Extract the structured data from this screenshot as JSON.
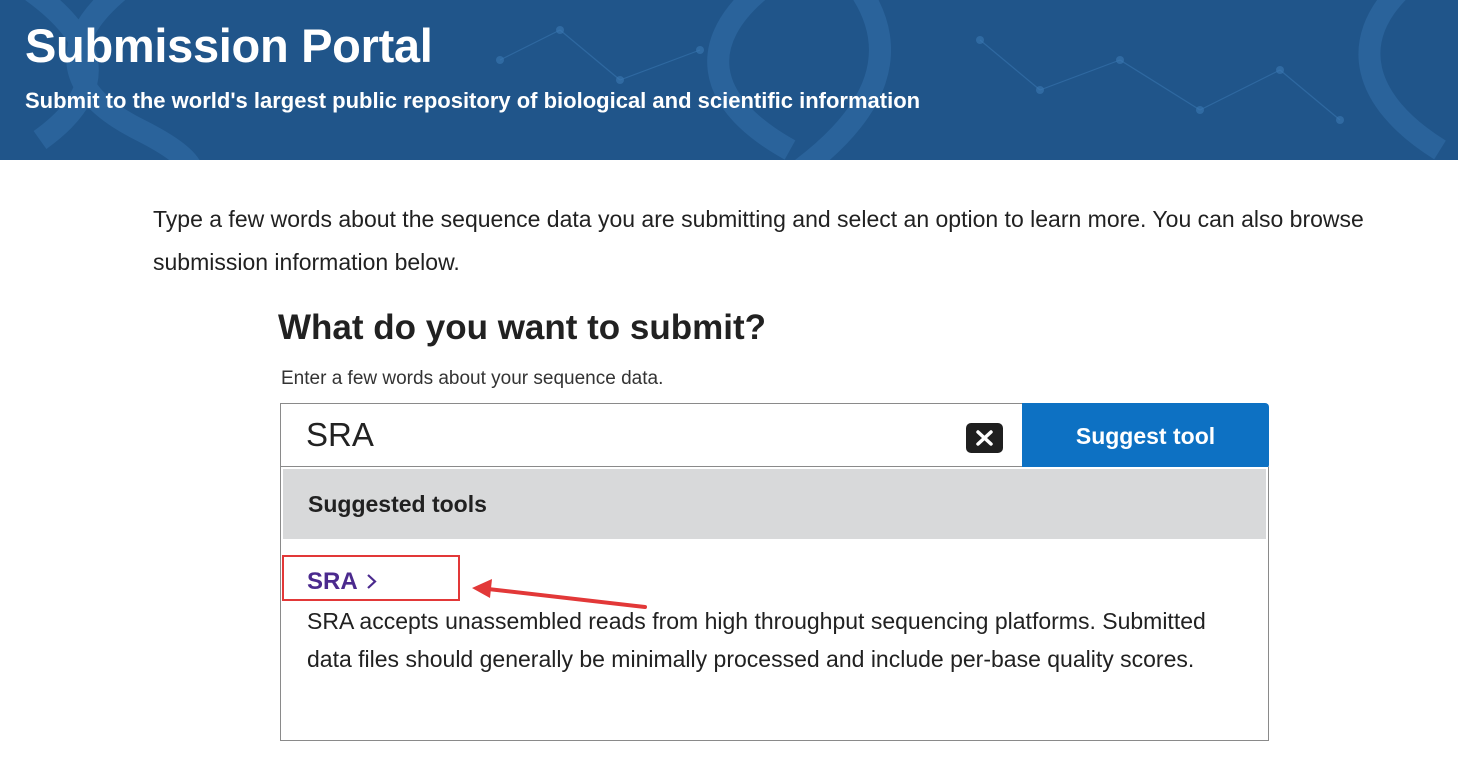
{
  "banner": {
    "title": "Submission Portal",
    "subtitle": "Submit to the world's largest public repository of biological and scientific information",
    "background_color": "#20558a",
    "decoration_icon": "dna-helix-icon"
  },
  "intro": {
    "text": "Type a few words about the sequence data you are submitting and select an option to learn more. You can also browse submission information below."
  },
  "search": {
    "heading": "What do you want to submit?",
    "hint": "Enter a few words about your sequence data.",
    "value": "SRA",
    "clear_icon": "close-icon",
    "button_label": "Suggest tool",
    "button_color": "#0d71c3"
  },
  "results": {
    "header": "Suggested tools",
    "items": [
      {
        "label": "SRA",
        "icon": "chevron-right-icon",
        "description": "SRA accepts unassembled reads from high throughput sequencing platforms. Submitted data files should generally be minimally processed and include per-base quality scores.",
        "link_color": "#4b2a8e"
      }
    ]
  },
  "annotation": {
    "highlight_color": "#e23838",
    "icon": "red-arrow-icon"
  }
}
